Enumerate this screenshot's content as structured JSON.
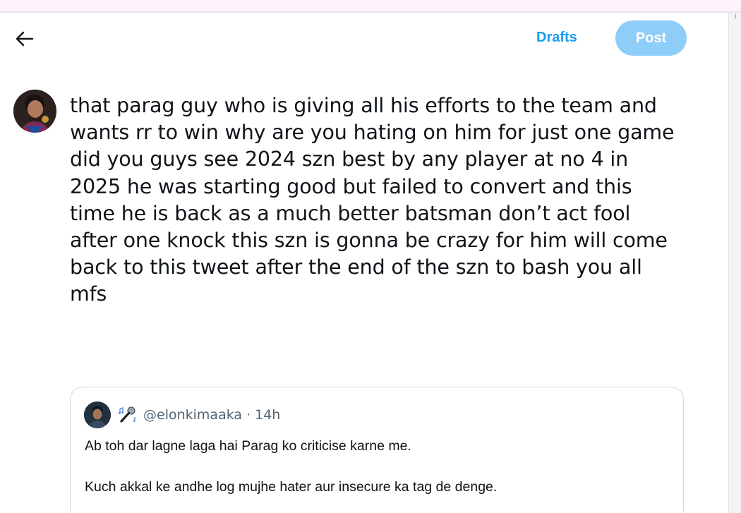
{
  "header": {
    "drafts_label": "Drafts",
    "post_label": "Post",
    "post_color": "#8ecdf8",
    "accent_color": "#1d9bf0"
  },
  "composer": {
    "lines": [
      "that parag guy who is giving all his efforts to the team and",
      "wants rr to win why are you hating on him for just one game",
      "did you guys see 2024 szn best by any player at no 4 in",
      "2025 he was starting good but failed to convert and this",
      "time he is back as a much better batsman don’t act fool",
      "after one knock this szn is gonna be crazy for him will come",
      "back to this tweet after the end of the szn to bash you all",
      "mfs"
    ]
  },
  "quoted_post": {
    "handle": "@elonkimaaka",
    "separator": "·",
    "time": "14h",
    "paragraphs": [
      "Ab toh dar lagne laga hai Parag ko criticise karne me.",
      "Kuch akkal ke andhe log mujhe hater aur insecure ka tag de denge."
    ],
    "emoji_icon": "microphone-music-icon"
  },
  "icons": {
    "back": "arrow-left-icon"
  }
}
